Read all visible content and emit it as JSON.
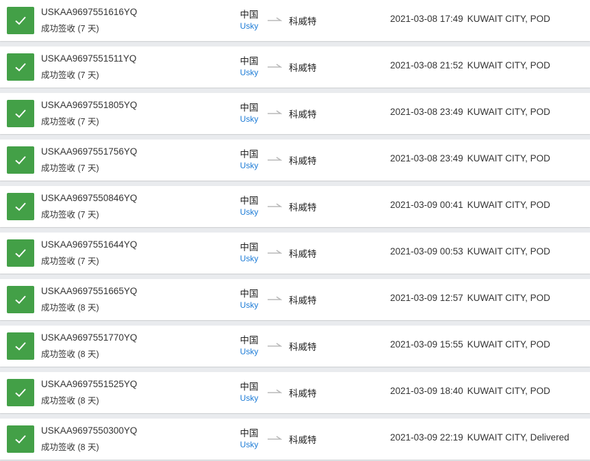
{
  "colors": {
    "check_bg": "#43a047",
    "carrier_link": "#1a7ad6",
    "page_bg": "#e9ebee"
  },
  "icons": {
    "status": "check-icon",
    "route": "arrow-right-icon"
  },
  "shipments": [
    {
      "tracking": "USKAA9697551616YQ",
      "status": "成功签收 (7 天)",
      "origin": "中国",
      "carrier": "Usky",
      "destination": "科威特",
      "time": "2021-03-08 17:49",
      "event": "KUWAIT CITY, POD"
    },
    {
      "tracking": "USKAA9697551511YQ",
      "status": "成功签收 (7 天)",
      "origin": "中国",
      "carrier": "Usky",
      "destination": "科威特",
      "time": "2021-03-08 21:52",
      "event": "KUWAIT CITY, POD"
    },
    {
      "tracking": "USKAA9697551805YQ",
      "status": "成功签收 (7 天)",
      "origin": "中国",
      "carrier": "Usky",
      "destination": "科威特",
      "time": "2021-03-08 23:49",
      "event": "KUWAIT CITY, POD"
    },
    {
      "tracking": "USKAA9697551756YQ",
      "status": "成功签收 (7 天)",
      "origin": "中国",
      "carrier": "Usky",
      "destination": "科威特",
      "time": "2021-03-08 23:49",
      "event": "KUWAIT CITY, POD"
    },
    {
      "tracking": "USKAA9697550846YQ",
      "status": "成功签收 (7 天)",
      "origin": "中国",
      "carrier": "Usky",
      "destination": "科威特",
      "time": "2021-03-09 00:41",
      "event": "KUWAIT CITY, POD"
    },
    {
      "tracking": "USKAA9697551644YQ",
      "status": "成功签收 (7 天)",
      "origin": "中国",
      "carrier": "Usky",
      "destination": "科威特",
      "time": "2021-03-09 00:53",
      "event": "KUWAIT CITY, POD"
    },
    {
      "tracking": "USKAA9697551665YQ",
      "status": "成功签收 (8 天)",
      "origin": "中国",
      "carrier": "Usky",
      "destination": "科威特",
      "time": "2021-03-09 12:57",
      "event": "KUWAIT CITY, POD"
    },
    {
      "tracking": "USKAA9697551770YQ",
      "status": "成功签收 (8 天)",
      "origin": "中国",
      "carrier": "Usky",
      "destination": "科威特",
      "time": "2021-03-09 15:55",
      "event": "KUWAIT CITY, POD"
    },
    {
      "tracking": "USKAA9697551525YQ",
      "status": "成功签收 (8 天)",
      "origin": "中国",
      "carrier": "Usky",
      "destination": "科威特",
      "time": "2021-03-09 18:40",
      "event": "KUWAIT CITY, POD"
    },
    {
      "tracking": "USKAA9697550300YQ",
      "status": "成功签收 (8 天)",
      "origin": "中国",
      "carrier": "Usky",
      "destination": "科威特",
      "time": "2021-03-09 22:19",
      "event": "KUWAIT CITY, Delivered"
    }
  ]
}
